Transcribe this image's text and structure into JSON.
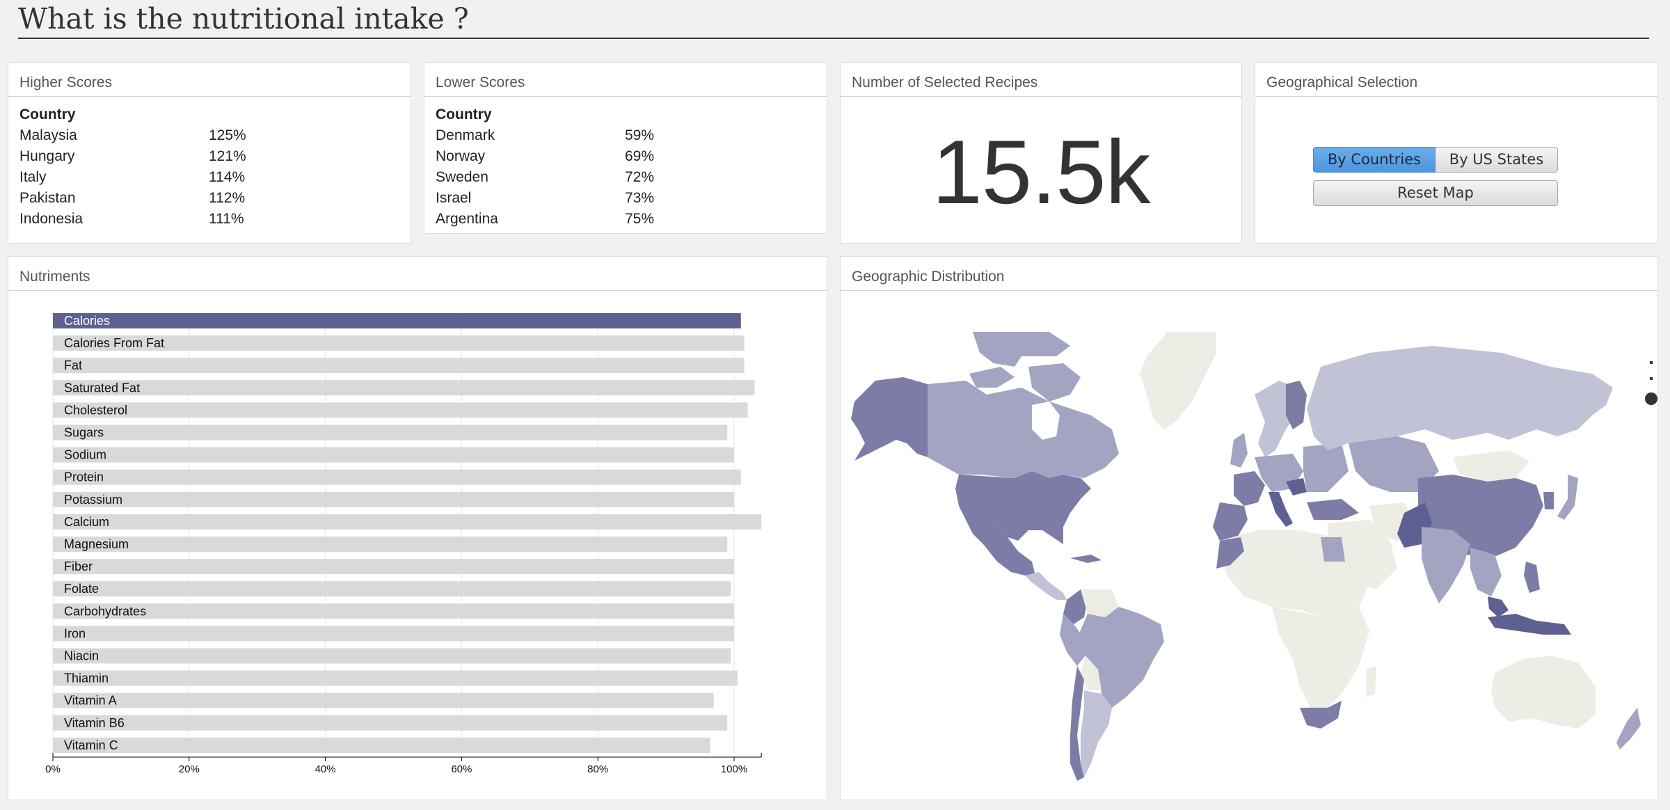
{
  "title": "What is the nutritional intake ?",
  "higher": {
    "header": "Higher Scores",
    "col": "Country",
    "rows": [
      {
        "country": "Malaysia",
        "value": "125%"
      },
      {
        "country": "Hungary",
        "value": "121%"
      },
      {
        "country": "Italy",
        "value": "114%"
      },
      {
        "country": "Pakistan",
        "value": "112%"
      },
      {
        "country": "Indonesia",
        "value": "111%"
      }
    ]
  },
  "lower": {
    "header": "Lower Scores",
    "col": "Country",
    "rows": [
      {
        "country": "Denmark",
        "value": "59%"
      },
      {
        "country": "Norway",
        "value": "69%"
      },
      {
        "country": "Sweden",
        "value": "72%"
      },
      {
        "country": "Israel",
        "value": "73%"
      },
      {
        "country": "Argentina",
        "value": "75%"
      }
    ]
  },
  "recipes": {
    "header": "Number of Selected Recipes",
    "value": "15.5k"
  },
  "geo_selection": {
    "header": "Geographical Selection",
    "by_countries": "By Countries",
    "by_states": "By US States",
    "reset": "Reset Map"
  },
  "nutriments": {
    "header": "Nutriments"
  },
  "geo_distribution": {
    "header": "Geographic Distribution"
  },
  "colors": {
    "selected_bar": "#5e6092",
    "bar": "#d9d9d9",
    "map_dark": "#7c7ca7",
    "map_mid": "#a3a3c2",
    "map_light": "#c2c2d6",
    "map_none": "#ededE6"
  },
  "chart_data": {
    "type": "bar",
    "orientation": "horizontal",
    "categories": [
      "Calories",
      "Calories From Fat",
      "Fat",
      "Saturated Fat",
      "Cholesterol",
      "Sugars",
      "Sodium",
      "Protein",
      "Potassium",
      "Calcium",
      "Magnesium",
      "Fiber",
      "Folate",
      "Carbohydrates",
      "Iron",
      "Niacin",
      "Thiamin",
      "Vitamin A",
      "Vitamin B6",
      "Vitamin C"
    ],
    "values": [
      101,
      101.5,
      101.5,
      103,
      102,
      99,
      100,
      101,
      100,
      104,
      99,
      100,
      99.5,
      100,
      100,
      99.5,
      100.5,
      97,
      99,
      96.5
    ],
    "selected": "Calories",
    "xlim": [
      0,
      104
    ],
    "xticks": [
      "0%",
      "20%",
      "40%",
      "60%",
      "80%",
      "100%"
    ],
    "xtick_values": [
      0,
      20,
      40,
      60,
      80,
      100
    ],
    "grid": true
  }
}
